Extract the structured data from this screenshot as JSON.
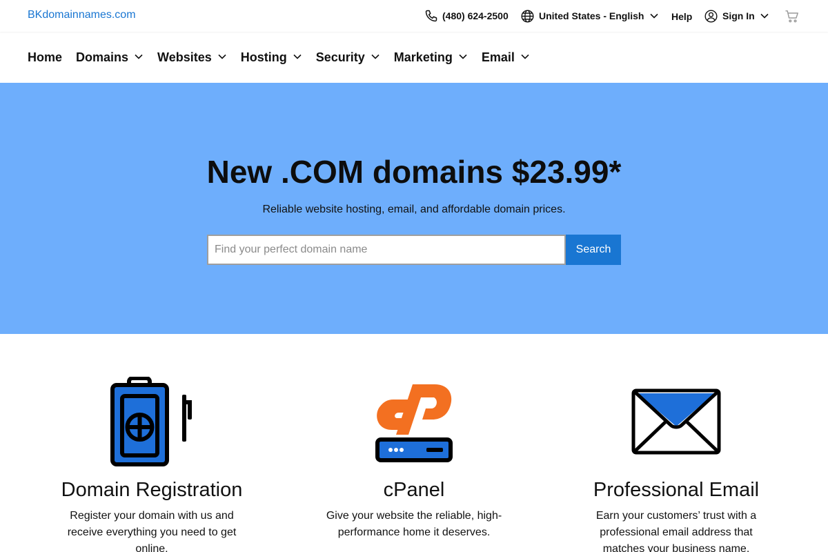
{
  "brand": {
    "name": "BKdomainnames.com"
  },
  "utility": {
    "phone": "(480) 624-2500",
    "locale": "United States - English",
    "help": "Help",
    "sign_in": "Sign In",
    "icons": [
      "phone-icon",
      "globe-icon",
      "user-circle-icon",
      "cart-icon",
      "chevron-down-icon"
    ]
  },
  "nav": {
    "items": [
      {
        "label": "Home",
        "has_dropdown": false
      },
      {
        "label": "Domains",
        "has_dropdown": true
      },
      {
        "label": "Websites",
        "has_dropdown": true
      },
      {
        "label": "Hosting",
        "has_dropdown": true
      },
      {
        "label": "Security",
        "has_dropdown": true
      },
      {
        "label": "Marketing",
        "has_dropdown": true
      },
      {
        "label": "Email",
        "has_dropdown": true
      }
    ]
  },
  "hero": {
    "title": "New .COM domains $23.99*",
    "subtitle": "Reliable website hosting, email, and affordable domain prices.",
    "search_placeholder": "Find your perfect domain name",
    "search_value": "",
    "search_button": "Search",
    "background_color": "#6eaefc"
  },
  "features": [
    {
      "icon": "domain-registration-icon",
      "title": "Domain Registration",
      "description": "Register your domain with us and receive everything you need to get online."
    },
    {
      "icon": "cpanel-icon",
      "title": "cPanel",
      "description": "Give your website the reliable, high-performance home it deserves."
    },
    {
      "icon": "email-envelope-icon",
      "title": "Professional Email",
      "description": "Earn your customers’ trust with a professional email address that matches your business name."
    }
  ],
  "colors": {
    "accent_blue": "#1976d2",
    "icon_blue": "#1e6fd9",
    "cpanel_orange": "#f37021",
    "text": "#111111"
  }
}
